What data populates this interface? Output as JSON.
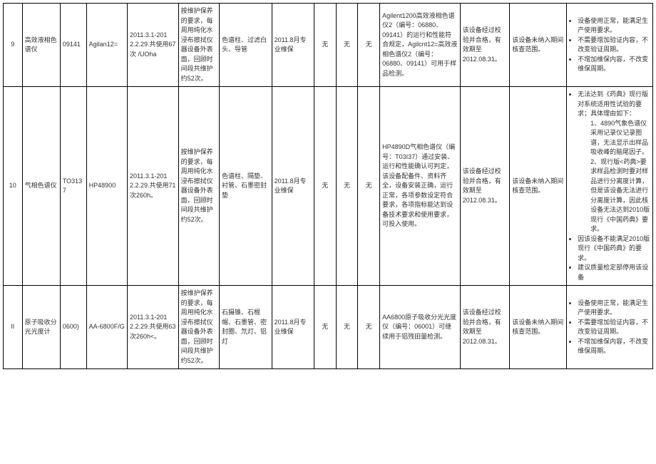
{
  "rows": [
    {
      "no": "9",
      "name": "高效液相色谱仪",
      "code": "09141",
      "model": "Agilan12=",
      "usage": "2011.3.1-201 2.2.29.共使用67次 /UOha",
      "maint": "按维护保养的要求，每周用纯化水浸布擦拭仪器设备外表面，回顾时间段共维护约52次。",
      "parts": "色谱柱、过滤白头、导管",
      "svc": "2011.8月专业维保",
      "c8": "无",
      "c9": "无",
      "c10": "无",
      "alt": "Agilent1200高效液相色谱仪2（编号：06880、09141）的运行和性能符合规定，Agilcnt12=高效液相色谱仪2（编号：06880、09141）可用于样品检测。",
      "cal": "该设备经过校验并合格，有效期至2012.08.31。",
      "period": "该设备未纳入期间核查范围。",
      "concl_bullets": [
        "设备使用正常，能满足生产使用要求。",
        "不需要增加验证内容，不改变验证周期。",
        "不增加维保内容，不改变维保周期。"
      ]
    },
    {
      "no": "10",
      "name": "气相色谱仪",
      "code": "TO3137",
      "model": "HP48900",
      "usage": "2011.3.1-201 2.2.29.共使用71次260h。",
      "maint": "按维护保养的要求，每周用纯化水浸布擦拭仪器设备外表面，回顾时间段共维护约52次。",
      "parts": "色谱柱、隔垫、衬管、石墨密封垫",
      "svc": "2011.8月专业维保",
      "c8": "无",
      "c9": "无",
      "c10": "无",
      "alt": "HP4890D气相色谱仪（编号：T03I37）通过安装、运行和性能确认可判定，该设备配备件、资料齐全，设备安装正确，运行正常，各项参数设定符合要求，各项指标能达到设备技术要求和使用要求，可投入使用。",
      "cal": "该设备经过校验并合格，有效期至2012.08.31。",
      "period": "该设备未纳入期间核查范围。",
      "concl_special": {
        "intro": "无法达到《药典》现行版对系统适用性试验的要求；具体理由如下：",
        "sub": [
          "1、4890气象色谱仪采用记录仪记录图谱，无法显示出样品吸收峰的脑尾因子。",
          "2、现行版<药典>要求样品检测时要对样品进行分离度计算，但是该设备无法进行分离度计算，因此核设备无法达到2010版现行《中国药典》要求。"
        ],
        "tail_bullets": [
          "因该设备不能满足2010版现行《中国药典》的要求。",
          "建议质量检定部停用该设备"
        ]
      }
    },
    {
      "no": "II",
      "name": "原子吸收分光光度计",
      "code": "0600)",
      "model": "AA-6800F/G",
      "usage": "2011.3.1-201 2.2.29.共使用63次260h<。",
      "maint": "按维护保养的要求，每周用纯化水浸布擦拭仪器设备外表面，回顾时间段共维护约52次。",
      "parts": "石摄锥、石棍帽、石墨管、密封圈、氘灯、铝灯",
      "svc": "2011.8月专业维保",
      "c8": "无",
      "c9": "无",
      "c10": "无",
      "alt": "AA6800原子吸收分光光度仪（编号：06001）可继续用于铝残田量检测。",
      "cal": "该设备经过校验并合格，有效期至 2012.08.31。",
      "period": "该设备未纳入期间核查范围。",
      "concl_bullets": [
        "设备使用正常，能满足生产使用要求。",
        "不需要增加验证内容，不改变验证周期。",
        "不增加维保内容，不改变维保周期。"
      ]
    }
  ]
}
